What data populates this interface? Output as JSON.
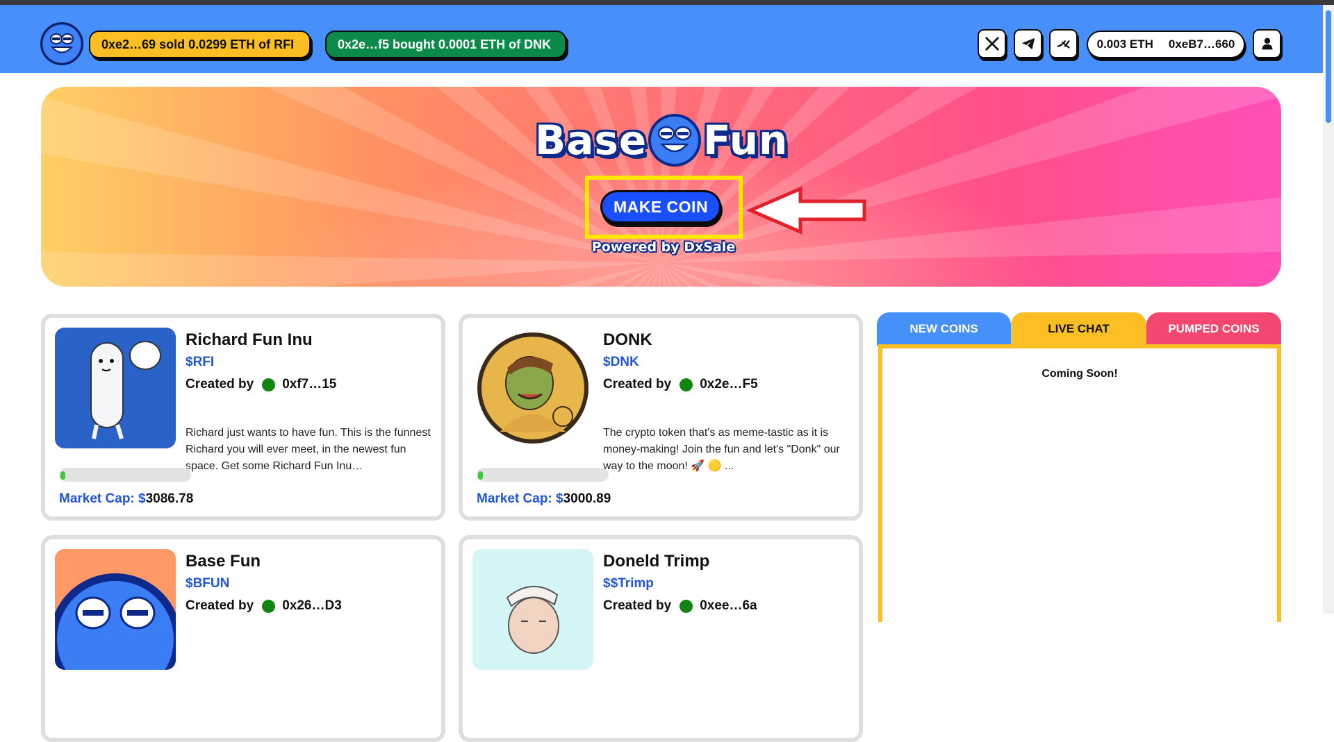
{
  "header": {
    "ticker_sold": "0xe2…69 sold 0.0299 ETH of RFI",
    "ticker_bought": "0x2e…f5 bought 0.0001 ETH of DNK",
    "wallet_balance": "0.003 ETH",
    "wallet_address": "0xeB7…660",
    "icons": [
      "x-icon",
      "telegram-icon",
      "dx-icon",
      "user-icon"
    ]
  },
  "hero": {
    "brand_left": "Base",
    "brand_right": "Fun",
    "make_coin_label": "MAKE COIN",
    "powered_by": "Powered by DxSale"
  },
  "coins": [
    {
      "name": "Richard Fun Inu",
      "symbol": "$RFI",
      "created_by_label": "Created by",
      "creator": "0xf7…15",
      "description": "Richard just wants to have fun. This is the funnest Richard you will ever meet, in the newest fun space. Get some Richard Fun Inu…",
      "market_cap_label": "Market Cap: $",
      "market_cap": "3086.78",
      "progress": 0.03
    },
    {
      "name": "DONK",
      "symbol": "$DNK",
      "created_by_label": "Created by",
      "creator": "0x2e…F5",
      "description": "The crypto token that's as meme-tastic as it is money-making! Join the fun and let's \"Donk\" our way to the moon! 🚀 🟡 ...",
      "market_cap_label": "Market Cap: $",
      "market_cap": "3000.89",
      "progress": 0.03
    },
    {
      "name": "Base Fun",
      "symbol": "$BFUN",
      "created_by_label": "Created by",
      "creator": "0x26…D3"
    },
    {
      "name": "Doneld Trimp",
      "symbol": "$$Trimp",
      "created_by_label": "Created by",
      "creator": "0xee…6a"
    }
  ],
  "sidebar": {
    "tabs": [
      {
        "label": "NEW COINS"
      },
      {
        "label": "LIVE CHAT"
      },
      {
        "label": "PUMPED COINS"
      }
    ],
    "active_tab": "LIVE CHAT",
    "chat_status": "Coming Soon!"
  },
  "colors": {
    "header_bg": "#478ffb",
    "accent_blue": "#1a4fff",
    "tab_new": "#4690fa",
    "tab_chat": "#fbbf24",
    "tab_pumped": "#f4476f",
    "highlight": "#ffe600",
    "arrow": "#e0202a"
  }
}
